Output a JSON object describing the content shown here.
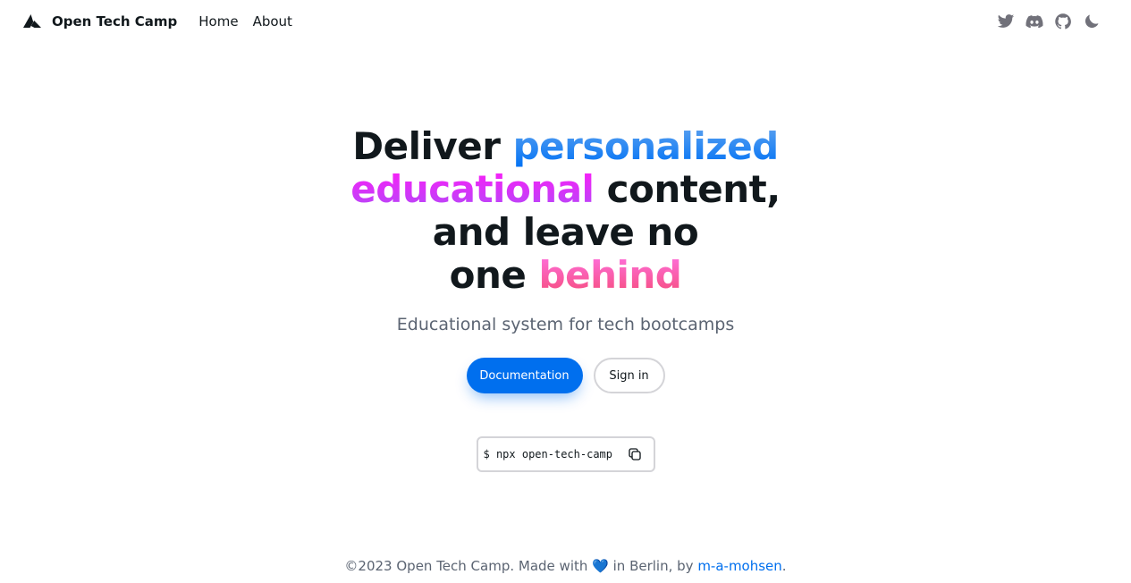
{
  "navbar": {
    "brand_name": "Open Tech Camp",
    "links": [
      {
        "label": "Home"
      },
      {
        "label": "About"
      }
    ],
    "icons": [
      "twitter-icon",
      "discord-icon",
      "github-icon",
      "moon-icon"
    ]
  },
  "hero": {
    "title": {
      "line1_a": "Deliver",
      "line1_b": "personalized",
      "line2_a": "educational",
      "line2_b": "content,",
      "line3": "and leave no",
      "line4_a": "one",
      "line4_b": "behind"
    },
    "subtitle": "Educational system for tech bootcamps",
    "primary_button": "Documentation",
    "secondary_button": "Sign in",
    "snippet": "$ npx open-tech-camp"
  },
  "footer": {
    "text_before": "©2023 Open Tech Camp. Made with",
    "heart": "💙",
    "text_middle": "in Berlin, by",
    "author_link": "m-a-mohsen",
    "text_after": "."
  },
  "colors": {
    "primary": "#006fee",
    "blue_gradient": "#5ea2ef",
    "violet_gradient": "#b249f8",
    "pink_gradient": "#f54c7a",
    "text": "#11181c",
    "muted": "#5b6472"
  }
}
